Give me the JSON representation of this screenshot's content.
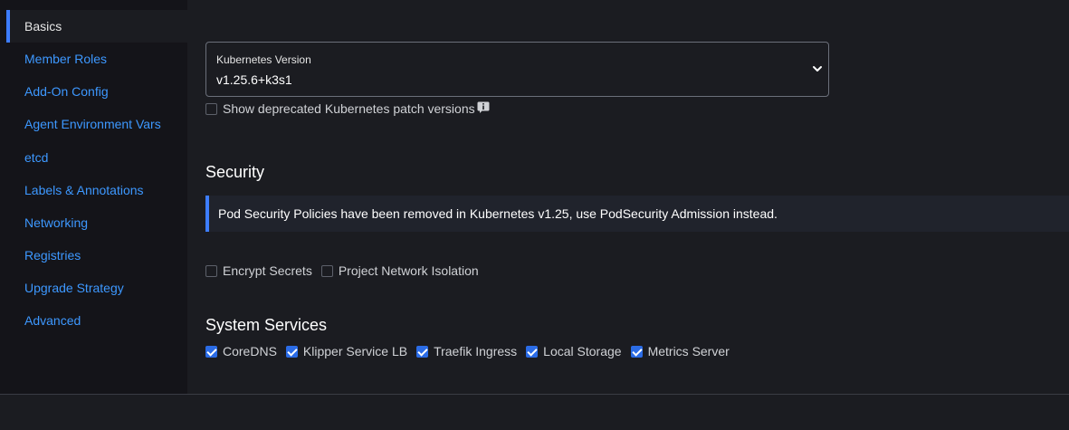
{
  "sidebar": {
    "items": [
      {
        "label": "Basics",
        "active": true
      },
      {
        "label": "Member Roles"
      },
      {
        "label": "Add-On Config"
      },
      {
        "label": "Agent Environment Vars"
      },
      {
        "label": "etcd"
      },
      {
        "label": "Labels & Annotations"
      },
      {
        "label": "Networking"
      },
      {
        "label": "Registries"
      },
      {
        "label": "Upgrade Strategy"
      },
      {
        "label": "Advanced"
      }
    ]
  },
  "basics": {
    "version_label": "Kubernetes Version",
    "version_value": "v1.25.6+k3s1",
    "show_deprecated_label": "Show deprecated Kubernetes patch versions",
    "show_deprecated_checked": false
  },
  "security": {
    "title": "Security",
    "banner": "Pod Security Policies have been removed in Kubernetes v1.25, use PodSecurity Admission instead.",
    "encrypt_secrets_label": "Encrypt Secrets",
    "encrypt_secrets_checked": false,
    "network_isolation_label": "Project Network Isolation",
    "network_isolation_checked": false
  },
  "system_services": {
    "title": "System Services",
    "items": [
      {
        "label": "CoreDNS",
        "checked": true
      },
      {
        "label": "Klipper Service LB",
        "checked": true
      },
      {
        "label": "Traefik Ingress",
        "checked": true
      },
      {
        "label": "Local Storage",
        "checked": true
      },
      {
        "label": "Metrics Server",
        "checked": true
      }
    ]
  },
  "colors": {
    "accent": "#3d7dff",
    "link": "#3d98ff",
    "background": "#1b1c21",
    "sidebar": "#141419"
  }
}
